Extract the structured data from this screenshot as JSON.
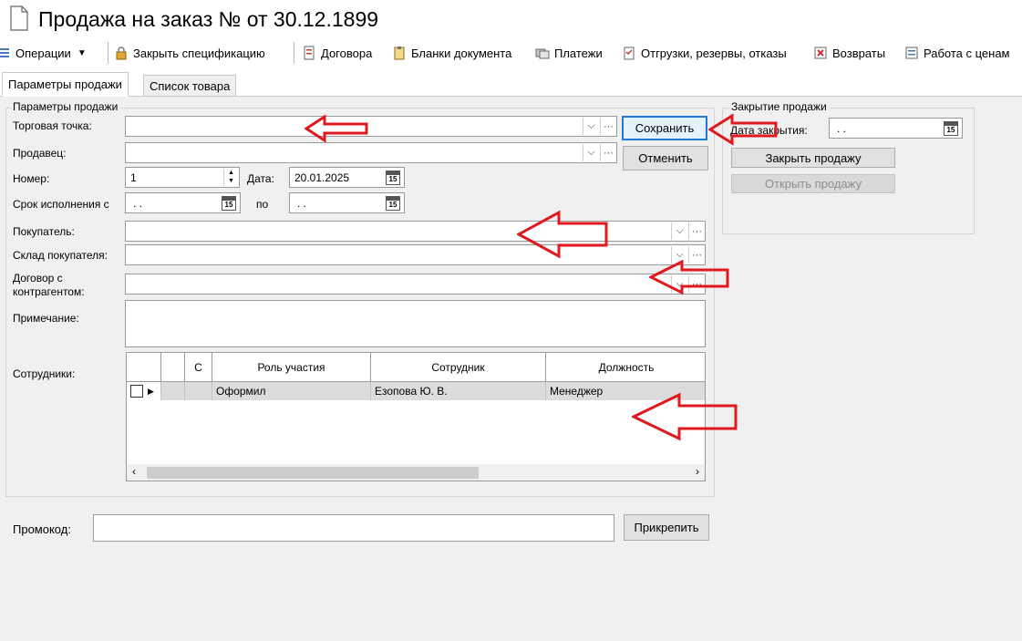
{
  "window": {
    "title": "Продажа на заказ №  от 30.12.1899"
  },
  "toolbar": {
    "operations": "Операции",
    "close_spec": "Закрыть спецификацию",
    "contracts": "Договора",
    "blanks": "Бланки документа",
    "payments": "Платежи",
    "shipments": "Отгрузки, резервы, отказы",
    "returns": "Возвраты",
    "prices": "Работа с ценам"
  },
  "tabs": [
    {
      "label": "Параметры продажи",
      "active": true
    },
    {
      "label": "Список товара",
      "active": false
    }
  ],
  "sale_params": {
    "group_title": "Параметры продажи",
    "trade_point_label": "Торговая точка:",
    "trade_point_value": "",
    "seller_label": "Продавец:",
    "seller_value": "",
    "number_label": "Номер:",
    "number_value": "1",
    "date_label": "Дата:",
    "date_value": "20.01.2025",
    "deadline_label": "Срок исполнения с",
    "deadline_from": ". .",
    "deadline_to_label": "по",
    "deadline_to": ". .",
    "buyer_label": "Покупатель:",
    "buyer_value": "",
    "buyer_warehouse_label": "Склад покупателя:",
    "buyer_warehouse_value": "",
    "contract_label_1": "Договор с",
    "contract_label_2": "контрагентом:",
    "contract_value": "",
    "note_label": "Примечание:",
    "note_value": "",
    "employees_label": "Сотрудники:",
    "calendar_day": "15",
    "ellipsis": "···"
  },
  "buttons": {
    "save": "Сохранить",
    "cancel": "Отменить",
    "attach": "Прикрепить"
  },
  "employees_grid": {
    "columns": [
      "С",
      "Роль участия",
      "Сотрудник",
      "Должность"
    ],
    "rows": [
      {
        "role": "Оформил",
        "employee": "Езопова Ю. В.",
        "position": "Менеджер"
      }
    ]
  },
  "closing": {
    "group_title": "Закрытие продажи",
    "close_date_label": "Дата закрытия:",
    "close_date_value": ". .",
    "close_button": "Закрыть продажу",
    "open_button": "Открыть продажу"
  },
  "promo": {
    "label": "Промокод:",
    "value": ""
  },
  "colors": {
    "accent": "#1e7ad6",
    "annotation": "#e0191f",
    "panel": "#f0f0f0"
  }
}
